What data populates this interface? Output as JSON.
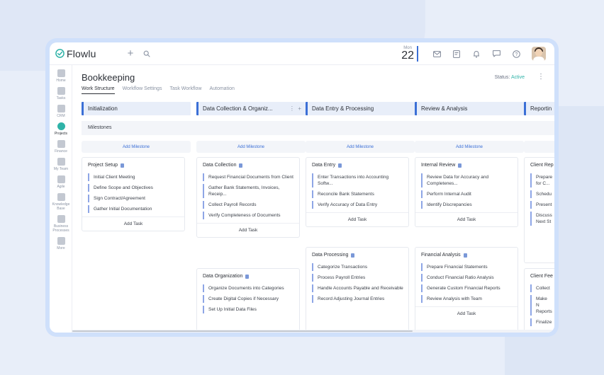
{
  "app": {
    "name": "Flowlu"
  },
  "topbar": {
    "date_mon": "Mon",
    "date_day": "22"
  },
  "sidebar": {
    "items": [
      {
        "label": "Home",
        "icon": "home-icon"
      },
      {
        "label": "Tasks",
        "icon": "tasks-icon"
      },
      {
        "label": "CRM",
        "icon": "crm-icon"
      },
      {
        "label": "Projects",
        "icon": "projects-icon",
        "active": true
      },
      {
        "label": "Finance",
        "icon": "finance-icon"
      },
      {
        "label": "My Team",
        "icon": "team-icon"
      },
      {
        "label": "Agile",
        "icon": "agile-icon"
      },
      {
        "label": "Knowledge Base",
        "icon": "knowledge-icon"
      },
      {
        "label": "Business Processes",
        "icon": "processes-icon"
      },
      {
        "label": "More",
        "icon": "more-icon"
      }
    ]
  },
  "page": {
    "title": "Bookkeeping",
    "status_label": "Status:",
    "status_value": "Active",
    "status_color": "#2fb3a8"
  },
  "tabs": [
    "Work Structure",
    "Workflow Settings",
    "Task Workflow",
    "Automation"
  ],
  "board": {
    "milestones_label": "Milestones",
    "add_milestone": "Add Milestone",
    "add_task": "Add Task",
    "columns": [
      {
        "title": "Initialization",
        "cards": [
          {
            "title": "Project Setup",
            "tasks": [
              "Initial Client Meeting",
              "Define Scope and Objectives",
              "Sign Contract/Agreement",
              "Gather Initial Documentation"
            ]
          }
        ]
      },
      {
        "title": "Data Collection & Organiz...",
        "cards": [
          {
            "title": "Data Collection",
            "tasks": [
              "Request Financial Documents from Client",
              "Gather Bank Statements, Invoices, Receip...",
              "Collect Payroll Records",
              "Verify Completeness of Documents"
            ]
          },
          {
            "title": "Data Organization",
            "tasks": [
              "Organize Documents into Categories",
              "Create Digital Copies if Necessary",
              "Set Up Initial Data Files"
            ]
          }
        ]
      },
      {
        "title": "Data Entry & Processing",
        "cards": [
          {
            "title": "Data Entry",
            "tasks": [
              "Enter Transactions into Accounting Softw...",
              "Reconcile Bank Statements",
              "Verify Accuracy of Data Entry"
            ]
          },
          {
            "title": "Data Processing",
            "tasks": [
              "Categorize Transactions",
              "Process Payroll Entries",
              "Handle Accounts Payable and Receivable",
              "Record Adjusting Journal Entries"
            ]
          }
        ]
      },
      {
        "title": "Review & Analysis",
        "cards": [
          {
            "title": "Internal Review",
            "tasks": [
              "Review Data for Accuracy and Completenes...",
              "Perform Internal Audit",
              "Identify Discrepancies"
            ]
          },
          {
            "title": "Financial Analysis",
            "tasks": [
              "Prepare Financial Statements",
              "Conduct Financial Ratio Analysis",
              "Generate Custom Financial Reports",
              "Review Analysis with Team"
            ]
          }
        ]
      },
      {
        "title": "Reportin",
        "cards": [
          {
            "title": "Client Rep",
            "tasks": [
              "Prepare for C...",
              "Schedu",
              "Present",
              "Discuss Next St"
            ]
          },
          {
            "title": "Client Fee",
            "tasks": [
              "Collect",
              "Make N Reports",
              "Finalize"
            ]
          }
        ]
      }
    ]
  }
}
